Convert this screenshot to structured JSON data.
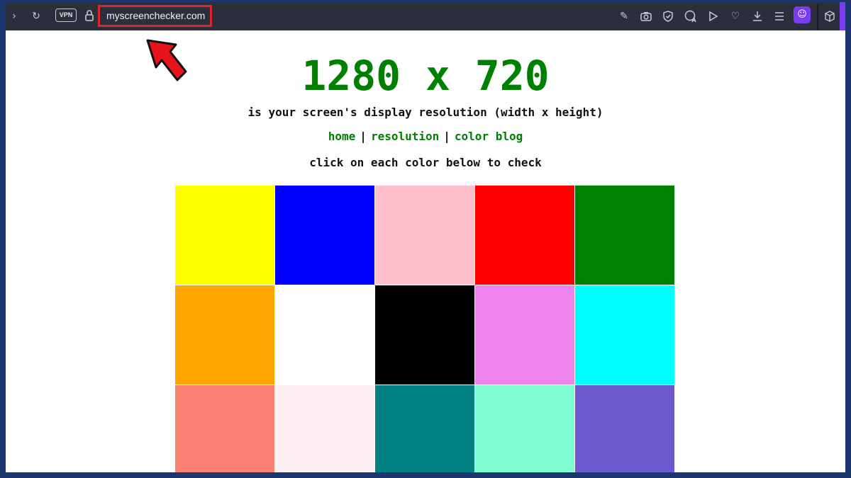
{
  "browser": {
    "vpn_label": "VPN",
    "url": "myscreenchecker.com",
    "icons": {
      "forward": "chevron-right-icon",
      "reload": "reload-icon",
      "lock": "lock-icon",
      "snapshot-edit": "pencil-icon",
      "camera": "camera-icon",
      "shield": "shield-icon",
      "translate": "translate-icon",
      "play": "play-icon",
      "heart": "heart-icon",
      "download": "download-icon",
      "menu": "menu-icon",
      "profile": "profile-icon",
      "cube": "cube-icon"
    }
  },
  "page": {
    "heading": "1280 x 720",
    "subtitle": "is your screen's display resolution (width x height)",
    "nav": {
      "home": "home",
      "separator": "|",
      "resolution": "resolution",
      "color_blog": "color blog"
    },
    "instruction": "click on each color below to check",
    "colors": [
      "#ffff00",
      "#0000ff",
      "#ffc0cb",
      "#ff0000",
      "#008000",
      "#ffa500",
      "#ffffff",
      "#000000",
      "#ee82ee",
      "#00ffff",
      "#fa8072",
      "#fff0f5",
      "#008080",
      "#7fffd4",
      "#6a5acd"
    ],
    "accent_color": "#008000",
    "highlight_color": "#e0262b"
  }
}
